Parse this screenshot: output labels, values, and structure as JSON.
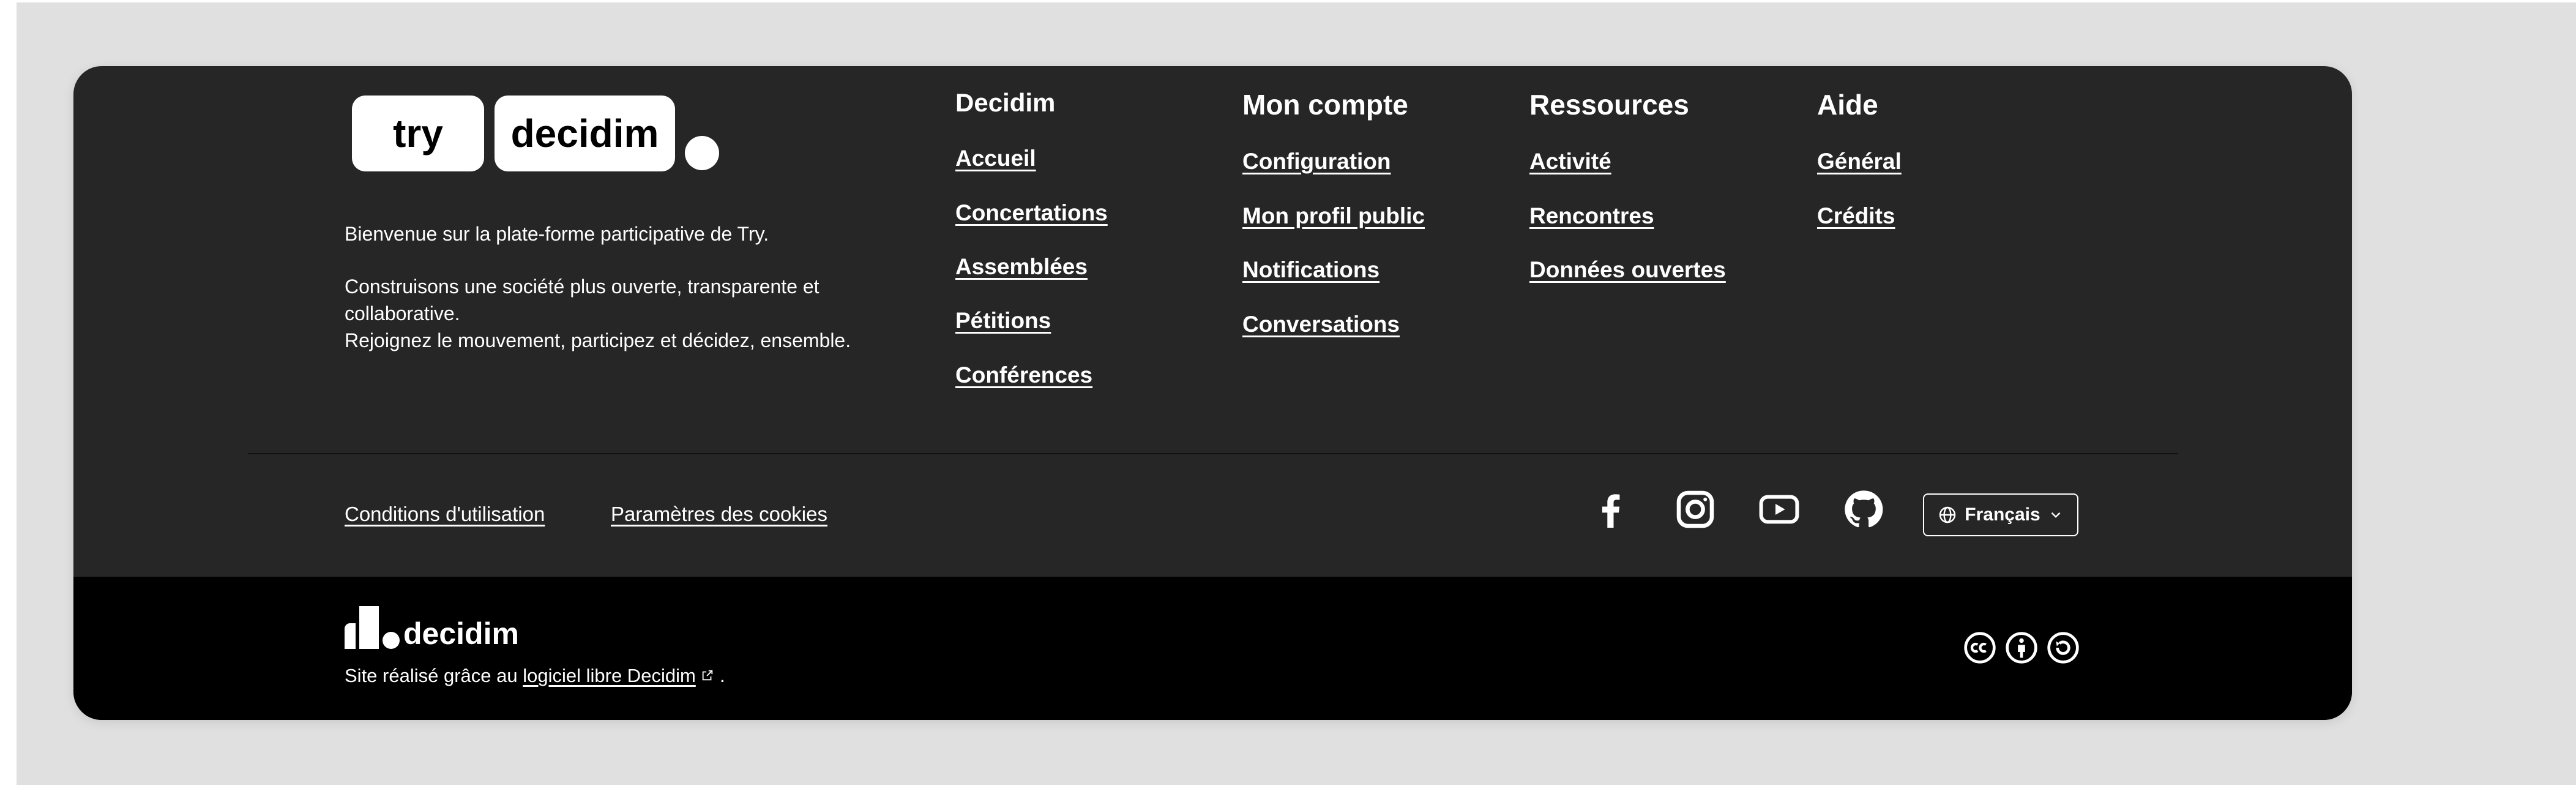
{
  "brand": {
    "logo_part1": "try",
    "logo_part2": "decidim",
    "bottom_logo_text": "decidim"
  },
  "intro": {
    "welcome": "Bienvenue sur la plate-forme participative de Try.",
    "line2": "Construisons une société plus ouverte, transparente et collaborative.",
    "line3": "Rejoignez le mouvement, participez et décidez, ensemble."
  },
  "columns": [
    {
      "title": "Decidim",
      "links": [
        "Accueil",
        "Concertations",
        "Assemblées",
        "Pétitions",
        "Conférences"
      ]
    },
    {
      "title": "Mon compte",
      "links": [
        "Configuration",
        "Mon profil public",
        "Notifications",
        "Conversations"
      ]
    },
    {
      "title": "Ressources",
      "links": [
        "Activité",
        "Rencontres",
        "Données ouvertes"
      ]
    },
    {
      "title": "Aide",
      "links": [
        "Général",
        "Crédits"
      ]
    }
  ],
  "legal": {
    "terms": "Conditions d'utilisation",
    "cookies": "Paramètres des cookies"
  },
  "social": [
    "facebook-icon",
    "instagram-icon",
    "youtube-icon",
    "github-icon"
  ],
  "language": {
    "current": "Français"
  },
  "credit": {
    "prefix": "Site réalisé grâce au",
    "link": "logiciel libre Decidim",
    "suffix": "."
  },
  "license_icons": [
    "creative-commons-icon",
    "attribution-icon",
    "share-alike-icon"
  ],
  "colors": {
    "page_background": "#e0e0e0",
    "footer_background": "#262626",
    "bottom_band": "#000000",
    "text": "#ffffff"
  }
}
